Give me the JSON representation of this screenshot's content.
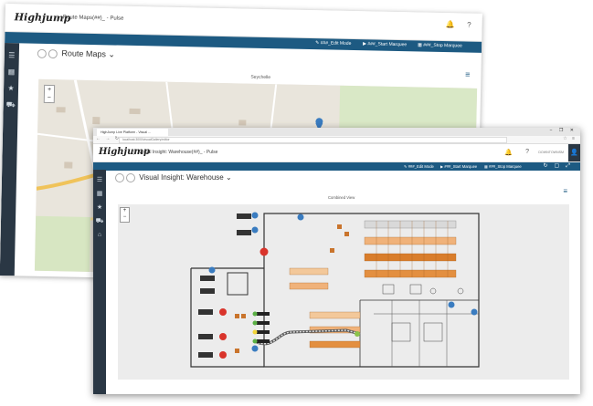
{
  "back_window": {
    "logo": "Highjump",
    "app_title": "Route Maps(##)_ - Pulse",
    "toolbar": {
      "edit_mode": "###_Edit Mode",
      "start_marquee": "###_Start Marquee",
      "stop_marquee": "###_Stop Marquee"
    },
    "page_title": "Route Maps",
    "subtitle": "Seychelle",
    "map": {
      "zoom_in": "+",
      "zoom_out": "−"
    }
  },
  "front_window": {
    "browser_tab": "HighJump Live Platform - Visual ...",
    "window_controls": "− ❐ ✕",
    "url": "localhost:3000/visualGallery/editor",
    "logo": "Highjump",
    "app_title": "Visual Insight: Warehouse(##)_ - Pulse",
    "username": "DOWNTOWNSM",
    "toolbar": {
      "edit_mode": "###_Edit Mode",
      "start_marquee": "###_Start Marquee",
      "stop_marquee": "###_Stop Marquee"
    },
    "page_title": "Visual Insight: Warehouse",
    "subtitle": "Combined View",
    "map": {
      "zoom_in": "+",
      "zoom_out": "−"
    }
  },
  "icons": {
    "menu": "☰",
    "grid": "▦",
    "star": "★",
    "truck": "⛟",
    "bank": "⌂",
    "bell": "🔔",
    "help": "?",
    "chevron": "⌄",
    "hamburger": "≡",
    "refresh": "↻",
    "export": "▢",
    "expand": "⤢",
    "user": "👤"
  },
  "colors": {
    "brand_blue": "#1d5a82",
    "sidebar": "#2a3744",
    "orange_dark": "#d97d2b",
    "orange_light": "#f3c89a",
    "pin": "#3a7cc0",
    "red": "#d9342b",
    "yellow": "#f2d43a",
    "green": "#5bb045"
  }
}
